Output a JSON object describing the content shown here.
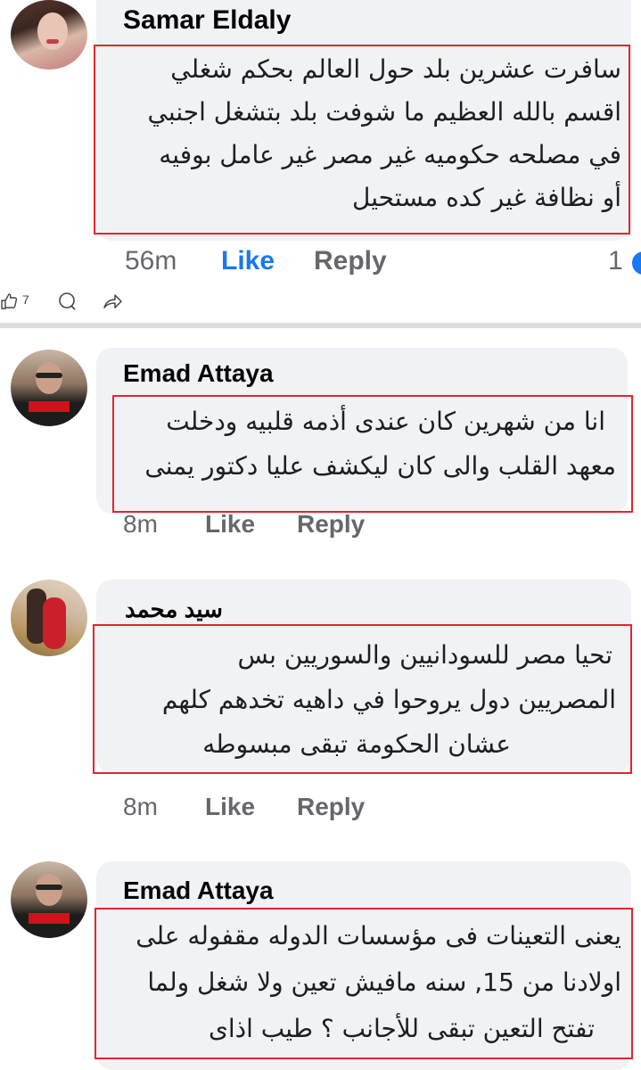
{
  "comments": [
    {
      "author": "Samar Eldaly",
      "lines": [
        "سافرت عشرين بلد حول العالم بحكم شغلي",
        "اقسم بالله العظيم ما شوفت بلد بتشغل اجنبي",
        "في مصلحه حكوميه غير مصر غير عامل بوفيه",
        "أو نظافة غير كده مستحيل"
      ],
      "time": "56m",
      "like": "Like",
      "reply": "Reply",
      "reaction_count": "1"
    },
    {
      "author": "Emad Attaya",
      "lines": [
        "انا من شهرين كان عندى أذمه قلبيه ودخلت",
        "معهد القلب والى كان ليكشف عليا دكتور يمنى"
      ],
      "time": "8m",
      "like": "Like",
      "reply": "Reply"
    },
    {
      "author": "سيد محمد",
      "lines": [
        "تحيا مصر للسودانيين والسوريين بس",
        "المصريين دول يروحوا في داهيه تخدهم كلهم",
        "عشان الحكومة تبقى مبسوطه"
      ],
      "time": "8m",
      "like": "Like",
      "reply": "Reply"
    },
    {
      "author": "Emad Attaya",
      "lines": [
        "يعنى التعينات فى مؤسسات الدوله مقفوله على",
        "اولادنا من 15, سنه مافيش تعين ولا شغل ولما",
        "تفتح التعين تبقى للأجانب ؟ طيب اذاى"
      ]
    }
  ],
  "post_actions": {
    "like_count": "7"
  },
  "colors": {
    "highlight": "#e0262e",
    "like_active": "#1877f2",
    "meta": "#65676b",
    "bubble": "#f0f2f5"
  }
}
